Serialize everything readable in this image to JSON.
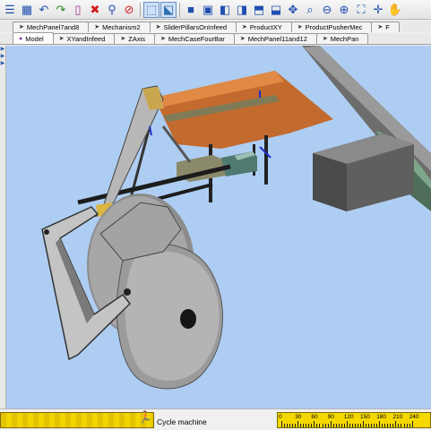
{
  "toolbar": {
    "buttons": [
      {
        "name": "list-icon",
        "glyph": "☰"
      },
      {
        "name": "grid-icon",
        "glyph": "▦"
      },
      {
        "name": "undo-icon",
        "glyph": "↶"
      },
      {
        "name": "redo-icon",
        "glyph": "↷"
      },
      {
        "name": "clipboard-icon",
        "glyph": "▯"
      },
      {
        "name": "delete-icon",
        "glyph": "✖"
      },
      {
        "name": "paint-icon",
        "glyph": "⚲"
      },
      {
        "name": "stop-icon",
        "glyph": "⊘"
      },
      {
        "name": "select-icon",
        "glyph": "⬚"
      },
      {
        "name": "select-move-icon",
        "glyph": "⬕"
      },
      {
        "name": "view-front-icon",
        "glyph": "■"
      },
      {
        "name": "view-back-icon",
        "glyph": "▣"
      },
      {
        "name": "view-left-icon",
        "glyph": "◧"
      },
      {
        "name": "view-right-icon",
        "glyph": "◨"
      },
      {
        "name": "view-top-icon",
        "glyph": "⬒"
      },
      {
        "name": "view-bottom-icon",
        "glyph": "⬓"
      },
      {
        "name": "rotate-icon",
        "glyph": "✥"
      },
      {
        "name": "zoom-fit-icon",
        "glyph": "⌕"
      },
      {
        "name": "zoom-out-icon",
        "glyph": "⊖"
      },
      {
        "name": "zoom-in-icon",
        "glyph": "⊕"
      },
      {
        "name": "fit-window-icon",
        "glyph": "⛶"
      },
      {
        "name": "pan-icon",
        "glyph": "✛"
      },
      {
        "name": "hand-icon",
        "glyph": "✋"
      }
    ]
  },
  "tabs_row1": [
    "MechPanel7and8",
    "Mechanism2",
    "SliderPillarsOnInfeed",
    "ProductXY",
    "ProductPusherMec",
    "F"
  ],
  "tabs_row2": [
    "Model",
    "XYandInfeed",
    "ZAxis",
    "MechCaseFourBar",
    "MechPanel11and12",
    "MechPan"
  ],
  "selected_tab": "Model",
  "status": {
    "cycle_label": "Cycle machine",
    "ruler_ticks": [
      "0",
      "30",
      "60",
      "90",
      "120",
      "150",
      "180",
      "210",
      "240"
    ]
  },
  "colors": {
    "viewport_bg": "#aecdf2",
    "timeline_yellow": "#f4d800",
    "tab_icon": "#7b3fa0"
  }
}
